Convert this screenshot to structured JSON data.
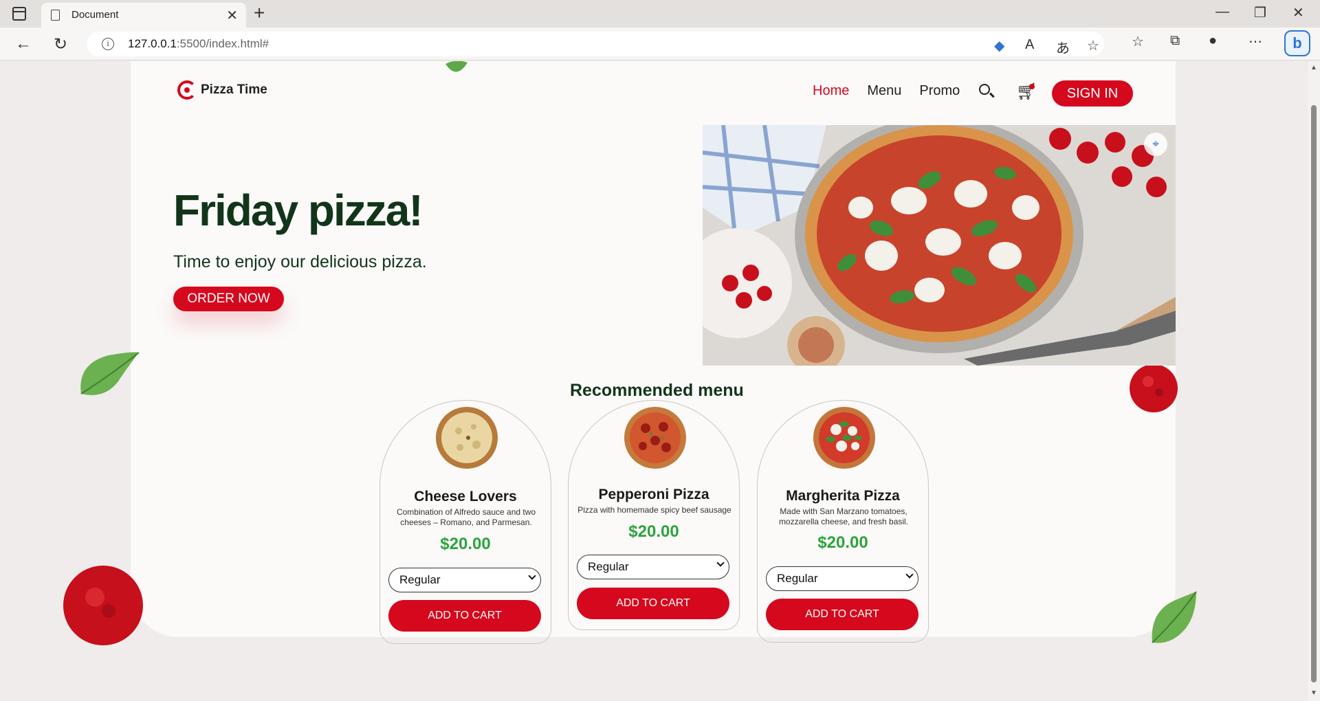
{
  "browser": {
    "tab_title": "Document",
    "url_host": "127.0.0.1",
    "url_rest": ":5500/index.html#"
  },
  "header": {
    "logo_text": "Pizza Time",
    "nav": [
      "Home",
      "Menu",
      "Promo"
    ],
    "signin_label": "SIGN IN"
  },
  "hero": {
    "title": "Friday pizza!",
    "subtitle": "Time to enjoy our delicious pizza.",
    "cta_label": "ORDER NOW"
  },
  "recommended": {
    "heading": "Recommended menu",
    "items": [
      {
        "name": "Cheese Lovers",
        "description": "Combination of Alfredo sauce and two cheeses – Romano, and Parmesan.",
        "price": "$20.00",
        "size": "Regular",
        "button": "ADD TO CART"
      },
      {
        "name": "Pepperoni Pizza",
        "description": "Pizza with homemade spicy beef sausage",
        "price": "$20.00",
        "size": "Regular",
        "button": "ADD TO CART"
      },
      {
        "name": "Margherita Pizza",
        "description": "Made with San Marzano tomatoes, mozzarella cheese, and fresh basil.",
        "price": "$20.00",
        "size": "Regular",
        "button": "ADD TO CART"
      }
    ]
  },
  "colors": {
    "accent": "#d5081d",
    "heading": "#12351a",
    "price": "#2ba43d"
  }
}
